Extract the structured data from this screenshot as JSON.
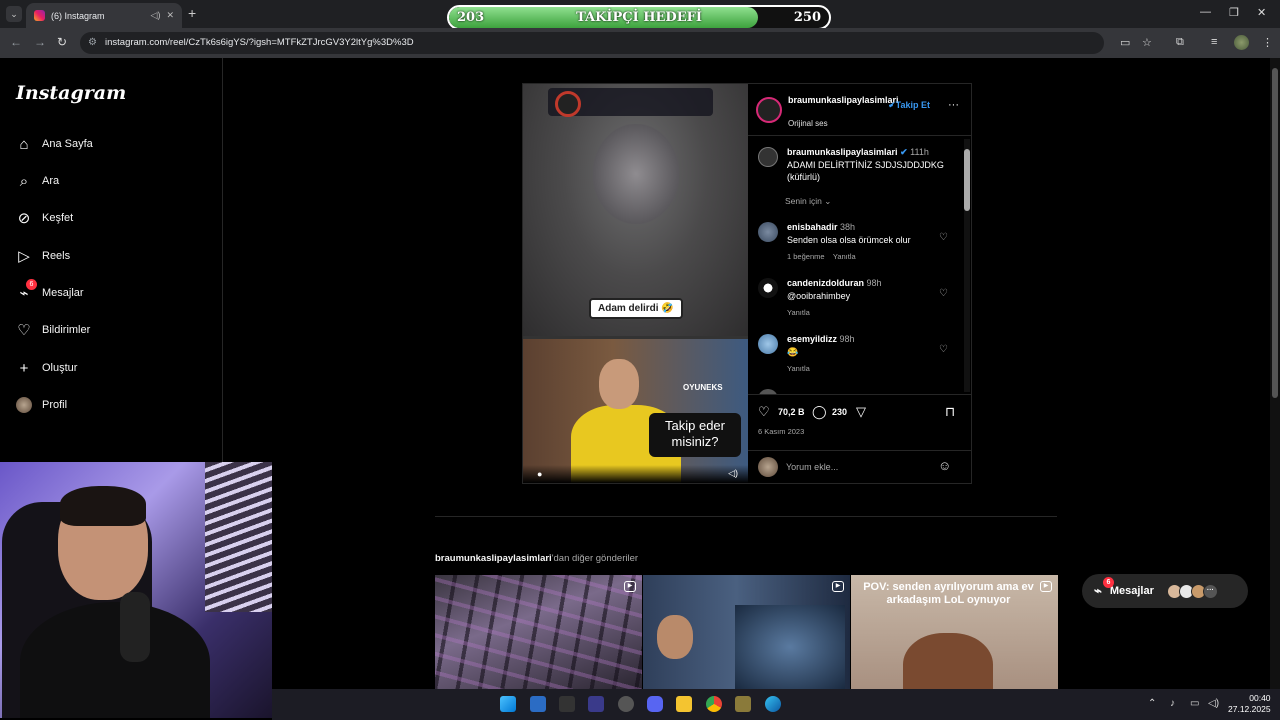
{
  "browser": {
    "tab_title": "(6) Instagram",
    "url": "instagram.com/reel/CzTk6s6igYS/?igsh=MTFkZTJrcGV3Y2ltYg%3D%3D"
  },
  "overlay": {
    "follower_goal": {
      "current": "203",
      "label": "TAKİPÇİ HEDEFİ",
      "target": "250",
      "progress_fraction": 0.812
    }
  },
  "sidebar": {
    "logo": "Instagram",
    "items": [
      {
        "label": "Ana Sayfa",
        "icon": "home-icon"
      },
      {
        "label": "Ara",
        "icon": "search-icon"
      },
      {
        "label": "Keşfet",
        "icon": "compass-icon"
      },
      {
        "label": "Reels",
        "icon": "reels-icon"
      },
      {
        "label": "Mesajlar",
        "icon": "messenger-icon",
        "badge": "6"
      },
      {
        "label": "Bildirimler",
        "icon": "heart-icon"
      },
      {
        "label": "Oluştur",
        "icon": "plus-icon"
      },
      {
        "label": "Profil",
        "icon": "avatar"
      }
    ]
  },
  "post": {
    "video": {
      "caption_sticker": "Adam delirdi 🤣",
      "brand": "OYUNEKS",
      "question": "Takip eder misiniz?"
    },
    "account": "braumunkaslipaylasimlari",
    "follow_label": "Takip Et",
    "audio": "Orijinal ses",
    "caption": {
      "user": "braumunkaslipaylasimlari",
      "time": "111h",
      "text": "ADAMI DELİRTTİNİZ SJDJSJDDJDKG (küfürlü)"
    },
    "for_you": "Senin için",
    "comments": [
      {
        "user": "enisbahadir",
        "time": "38h",
        "text": "Senden olsa olsa örümcek olur",
        "likes": "1 beğenme",
        "reply": "Yanıtla"
      },
      {
        "user": "candenizdolduran",
        "time": "98h",
        "text": "@ooibrahimbey",
        "likes": "",
        "reply": "Yanıtla"
      },
      {
        "user": "esemyildizz",
        "time": "98h",
        "text": "😂",
        "likes": "",
        "reply": "Yanıtla"
      }
    ],
    "likes_count": "70,2 B",
    "comments_count": "230",
    "date": "6 Kasım 2023",
    "comment_placeholder": "Yorum ekle..."
  },
  "more_posts": {
    "account": "braumunkaslipaylasimlari",
    "suffix": "'dan diğer gönderiler",
    "tiles": [
      {
        "text": ""
      },
      {
        "text": ""
      },
      {
        "text": "POV: senden ayrılıyorum ama ev arkadaşım LoL oynuyor"
      }
    ]
  },
  "messages_pill": {
    "label": "Mesajlar",
    "badge": "6"
  },
  "taskbar": {
    "time": "00:40",
    "date": "27.12.2025"
  }
}
